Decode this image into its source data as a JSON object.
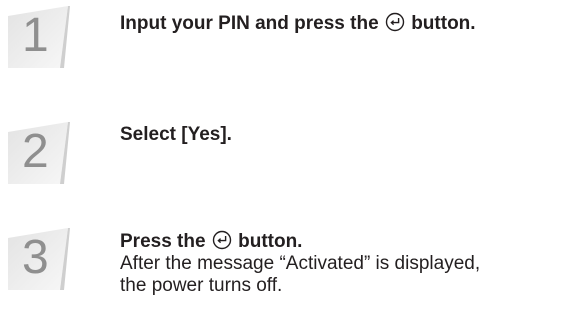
{
  "steps": [
    {
      "number": "1",
      "title_before": "Input your PIN and press the ",
      "title_icon": "enter-icon",
      "title_after": " button.",
      "description": ""
    },
    {
      "number": "2",
      "title_before": "Select [Yes].",
      "title_icon": "",
      "title_after": "",
      "description": ""
    },
    {
      "number": "3",
      "title_before": "Press the ",
      "title_icon": "enter-icon",
      "title_after": " button.",
      "description_line1": "After the message “Activated” is displayed,",
      "description_line2": "the power turns off."
    }
  ]
}
